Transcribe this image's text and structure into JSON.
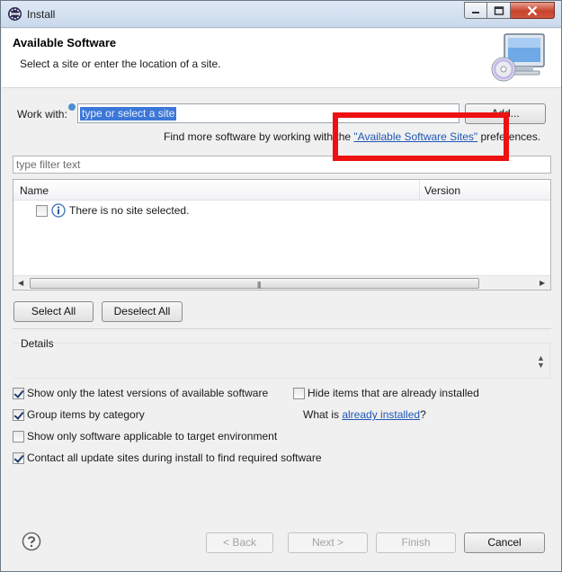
{
  "window": {
    "title": "Install"
  },
  "header": {
    "title": "Available Software",
    "description": "Select a site or enter the location of a site."
  },
  "work_with": {
    "label": "Work with:",
    "value": "type or select a site",
    "add_label": "Add..."
  },
  "find_more": {
    "prefix": "Find more software by working with the ",
    "link": "\"Available Software Sites\"",
    "suffix": " preferences."
  },
  "filter": {
    "placeholder": "type filter text"
  },
  "tree": {
    "columns": [
      "Name",
      "Version"
    ],
    "rows": [
      {
        "text": "There is no site selected.",
        "checked": false,
        "icon": "info-icon"
      }
    ]
  },
  "selection_buttons": {
    "select_all": "Select All",
    "deselect_all": "Deselect All"
  },
  "details": {
    "label": "Details"
  },
  "options": {
    "show_latest": {
      "label": "Show only the latest versions of available software",
      "checked": true
    },
    "group_by_category": {
      "label": "Group items by category",
      "checked": true
    },
    "applicable_only": {
      "label": "Show only software applicable to target environment",
      "checked": false
    },
    "contact_sites": {
      "label": "Contact all update sites during install to find required software",
      "checked": true
    },
    "hide_installed": {
      "label": "Hide items that are already installed",
      "checked": false
    }
  },
  "what_is": {
    "prefix": "What is ",
    "link": "already installed",
    "suffix": "?"
  },
  "footer": {
    "back": "< Back",
    "next": "Next >",
    "finish": "Finish",
    "cancel": "Cancel"
  },
  "colors": {
    "highlight": "#3b77d8",
    "link": "#1f57b5",
    "annotation_box": "#ee1111"
  }
}
